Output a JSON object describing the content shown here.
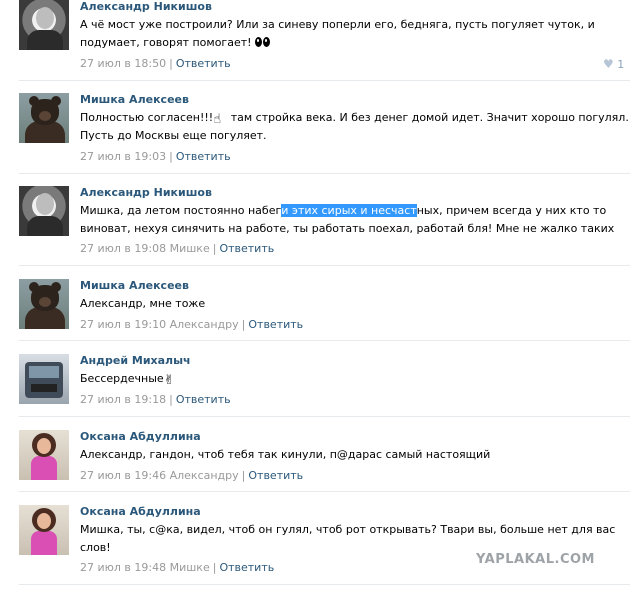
{
  "comments": [
    {
      "author": "Александр Никишов",
      "lines": [
        "А чё мост уже построили? Или за синеву поперли его, бедняга, пусть погуляет чуток, и",
        "подумает, говорят помогает!"
      ],
      "time": "27 июл в 18:50",
      "reply_label": "Ответить",
      "likes": "1",
      "avatar": "man-avatar"
    },
    {
      "author": "Мишка Алексеев",
      "lines": [
        "Полностью согласен!!!",
        " там стройка века. И без денег домой идет. Значит хорошо погулял.",
        "Пусть до Москвы еще погуляет."
      ],
      "time": "27 июл в 19:03",
      "reply_label": "Ответить",
      "avatar": "bear-avatar"
    },
    {
      "author": "Александр Никишов",
      "lines": [
        "Мишка, да летом постоянно набег",
        "и этих сирых и несчаст",
        "ных, причем всегда у них кто то",
        "виноват, нехуя синячить на работе, ты работать поехал, работай бля! Мне не жалко таких"
      ],
      "time": "27 июл в 19:08 Мишке",
      "reply_label": "Ответить",
      "avatar": "man-avatar"
    },
    {
      "author": "Мишка Алексеев",
      "lines": [
        "Александр, мне тоже"
      ],
      "time": "27 июл в 19:10 Александру",
      "reply_label": "Ответить",
      "avatar": "bear-avatar"
    },
    {
      "author": "Андрей Михалыч",
      "lines": [
        "Бессердечные"
      ],
      "time": "27 июл в 19:18",
      "reply_label": "Ответить",
      "avatar": "truck-avatar"
    },
    {
      "author": "Оксана Абдуллина",
      "lines": [
        "Александр, гандон, чтоб тебя так кинули, п@дарас самый настоящий"
      ],
      "time": "27 июл в 19:46 Александру",
      "reply_label": "Ответить",
      "avatar": "woman-avatar"
    },
    {
      "author": "Оксана Абдуллина",
      "lines": [
        "Мишка, ты, с@ка, видел, чтоб он гулял, чтоб рот открывать? Твари вы, больше нет для вас",
        "слов!"
      ],
      "time": "27 июл в 19:48 Мишке",
      "reply_label": "Ответить",
      "avatar": "woman-avatar"
    }
  ],
  "separator": "|",
  "watermark": "YAPLAKAL.COM",
  "colors": {
    "link": "#2b587a",
    "meta": "#999999",
    "selection": "#3399ff",
    "divider": "#e7eaed"
  }
}
